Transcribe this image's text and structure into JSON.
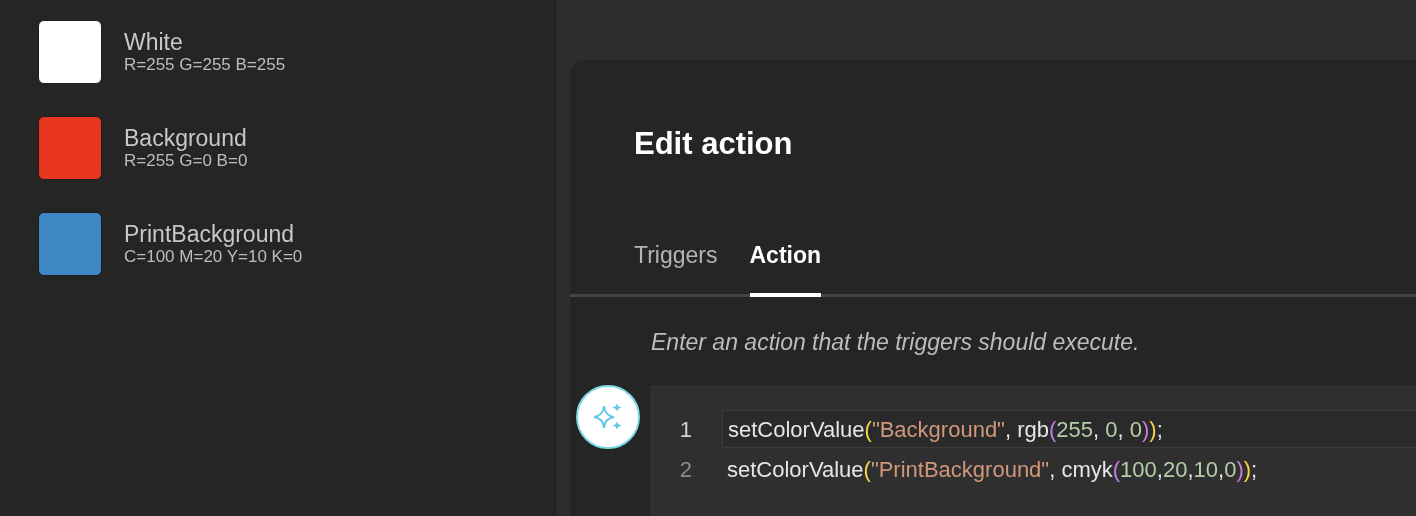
{
  "swatches": [
    {
      "name": "White",
      "values": "R=255 G=255 B=255",
      "color": "#ffffff"
    },
    {
      "name": "Background",
      "values": "R=255 G=0 B=0",
      "color": "#e8351f"
    },
    {
      "name": "PrintBackground",
      "values": "C=100 M=20 Y=10 K=0",
      "color": "#3f88c5"
    }
  ],
  "dialog": {
    "title": "Edit action",
    "tabs": [
      {
        "label": "Triggers",
        "selected": false
      },
      {
        "label": "Action",
        "selected": true
      }
    ],
    "hint": "Enter an action that the triggers should execute.",
    "code_lines": [
      {
        "number": "1",
        "selected": true,
        "tokens": [
          {
            "text": "setColorValue",
            "kind": "plain"
          },
          {
            "text": "(",
            "kind": "paren1"
          },
          {
            "text": "\"Background\"",
            "kind": "string"
          },
          {
            "text": ", rgb",
            "kind": "plain"
          },
          {
            "text": "(",
            "kind": "paren2"
          },
          {
            "text": "255",
            "kind": "number"
          },
          {
            "text": ", ",
            "kind": "plain"
          },
          {
            "text": "0",
            "kind": "number"
          },
          {
            "text": ", ",
            "kind": "plain"
          },
          {
            "text": "0",
            "kind": "number"
          },
          {
            "text": ")",
            "kind": "paren2"
          },
          {
            "text": ")",
            "kind": "paren1"
          },
          {
            "text": ";",
            "kind": "plain"
          }
        ]
      },
      {
        "number": "2",
        "selected": false,
        "tokens": [
          {
            "text": "setColorValue",
            "kind": "plain"
          },
          {
            "text": "(",
            "kind": "paren1"
          },
          {
            "text": "\"PrintBackground\"",
            "kind": "string"
          },
          {
            "text": ", cmyk",
            "kind": "plain"
          },
          {
            "text": "(",
            "kind": "paren2"
          },
          {
            "text": "100",
            "kind": "number"
          },
          {
            "text": ",",
            "kind": "plain"
          },
          {
            "text": "20",
            "kind": "number"
          },
          {
            "text": ",",
            "kind": "plain"
          },
          {
            "text": "10",
            "kind": "number"
          },
          {
            "text": ",",
            "kind": "plain"
          },
          {
            "text": "0",
            "kind": "number"
          },
          {
            "text": ")",
            "kind": "paren2"
          },
          {
            "text": ")",
            "kind": "paren1"
          },
          {
            "text": ";",
            "kind": "plain"
          }
        ]
      }
    ]
  }
}
